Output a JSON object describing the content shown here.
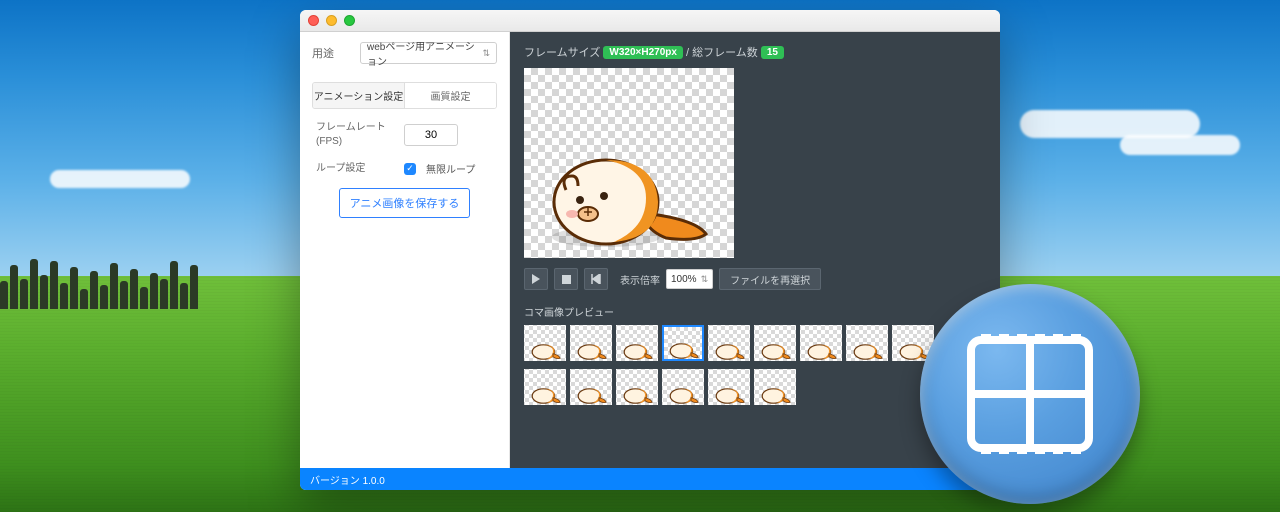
{
  "left": {
    "use_label": "用途",
    "use_value": "webページ用アニメーション",
    "tabs": {
      "anim": "アニメーション設定",
      "quality": "画質設定"
    },
    "fps_label": "フレームレート\n(FPS)",
    "fps_value": "30",
    "loop_label": "ループ設定",
    "loop_check_label": "無限ループ",
    "save_btn": "アニメ画像を保存する"
  },
  "right": {
    "frame_size_label": "フレームサイズ",
    "frame_size_value": "W320×H270px",
    "sep": " / ",
    "total_label": "総フレーム数",
    "total_value": "15",
    "scale_label": "表示倍率",
    "scale_value": "100%",
    "reselect": "ファイルを再選択",
    "thumbs_title": "コマ画像プレビュー",
    "frames_row1": 9,
    "frames_row2": 6,
    "selected_index": 3
  },
  "status": {
    "version": "バージョン 1.0.0"
  }
}
